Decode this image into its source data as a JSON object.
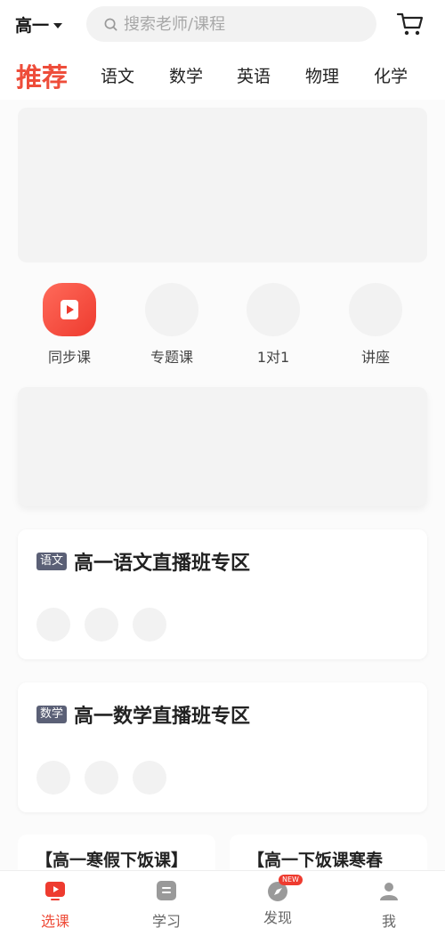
{
  "header": {
    "grade_label": "高一",
    "search_placeholder": "搜索老师/课程"
  },
  "tabs": [
    {
      "label": "推荐",
      "active": true
    },
    {
      "label": "语文"
    },
    {
      "label": "数学"
    },
    {
      "label": "英语"
    },
    {
      "label": "物理"
    },
    {
      "label": "化学"
    }
  ],
  "quick_entries": [
    {
      "label": "同步课",
      "icon": "play-icon"
    },
    {
      "label": "专题课"
    },
    {
      "label": "1对1"
    },
    {
      "label": "讲座"
    }
  ],
  "live_sections": [
    {
      "tag": "语文",
      "title": "高一语文直播班专区"
    },
    {
      "tag": "数学",
      "title": "高一数学直播班专区"
    }
  ],
  "courses": [
    {
      "title": "【高一寒假下饭课】"
    },
    {
      "title": "【高一下饭课寒春"
    }
  ],
  "bottom_nav": [
    {
      "label": "选课",
      "icon": "tv-play-icon",
      "active": true
    },
    {
      "label": "学习",
      "icon": "study-icon"
    },
    {
      "label": "发现",
      "icon": "discover-icon",
      "badge": "NEW"
    },
    {
      "label": "我",
      "icon": "profile-icon"
    }
  ],
  "colors": {
    "accent": "#ee4d3a",
    "tag_bg": "#5b6076"
  }
}
